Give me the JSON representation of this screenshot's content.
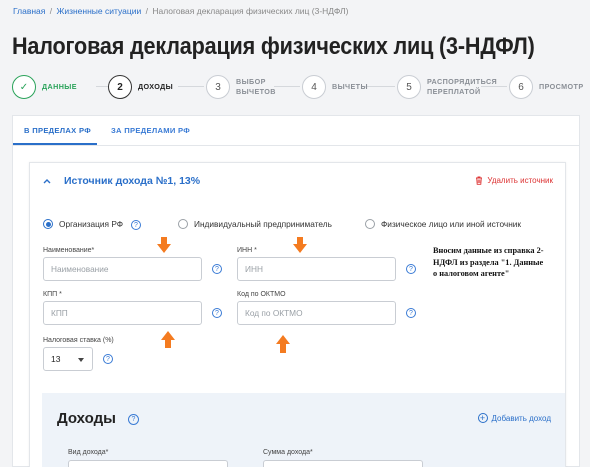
{
  "breadcrumb": {
    "home": "Главная",
    "section": "Жизненные ситуации",
    "current": "Налоговая декларация физических лиц (3-НДФЛ)",
    "separator": "/"
  },
  "page_title": "Налоговая декларация физических лиц (3-НДФЛ)",
  "stepper": {
    "steps": [
      {
        "number": "✓",
        "label": "Данные",
        "state": "done"
      },
      {
        "number": "2",
        "label": "Доходы",
        "state": "active"
      },
      {
        "number": "3",
        "label_line1": "Выбор",
        "label_line2": "вычетов",
        "state": "pending"
      },
      {
        "number": "4",
        "label": "Вычеты",
        "state": "pending"
      },
      {
        "number": "5",
        "label_line1": "Распорядиться",
        "label_line2": "переплатой",
        "state": "pending"
      },
      {
        "number": "6",
        "label": "Просмотр",
        "state": "pending"
      }
    ]
  },
  "tabs": [
    {
      "label": "В ПРЕДЕЛАХ РФ",
      "active": true
    },
    {
      "label": "ЗА ПРЕДЕЛАМИ РФ",
      "active": false
    }
  ],
  "income_source": {
    "title": "Источник дохода №1, 13%",
    "delete_label": "Удалить источник",
    "source_types": [
      {
        "label": "Организация РФ",
        "selected": true
      },
      {
        "label": "Индивидуальный предприниматель",
        "selected": false
      },
      {
        "label": "Физическое лицо или иной источник",
        "selected": false
      }
    ],
    "fields": {
      "name": {
        "label": "Наименование*",
        "placeholder": "Наименование",
        "value": ""
      },
      "inn": {
        "label": "ИНН *",
        "placeholder": "ИНН",
        "value": ""
      },
      "kpp": {
        "label": "КПП *",
        "placeholder": "КПП",
        "value": ""
      },
      "oktmo": {
        "label": "Код по ОКТМО",
        "placeholder": "Код по ОКТМО",
        "value": ""
      },
      "tax_rate": {
        "label": "Налоговая ставка (%)",
        "value": "13"
      }
    },
    "help_glyph": "?"
  },
  "annotation_note": "Вносим данные из справка 2-НДФЛ из раздела \"1. Данные о налоговом агенте\"",
  "incomes": {
    "title": "Доходы",
    "add_label": "Добавить доход",
    "field_labels": {
      "income_type": "Вид дохода*",
      "income_amount": "Сумма дохода*"
    }
  },
  "colors": {
    "accent": "#2a6fc9",
    "done": "#2aa35a",
    "delete": "#dd3333",
    "arrow": "#f47b20"
  },
  "icons": {
    "chevron": "chevron-up-icon",
    "delete": "trash-icon",
    "help": "question-circle-icon",
    "add": "plus-circle-icon",
    "annotation": "orange-arrow-icon"
  }
}
